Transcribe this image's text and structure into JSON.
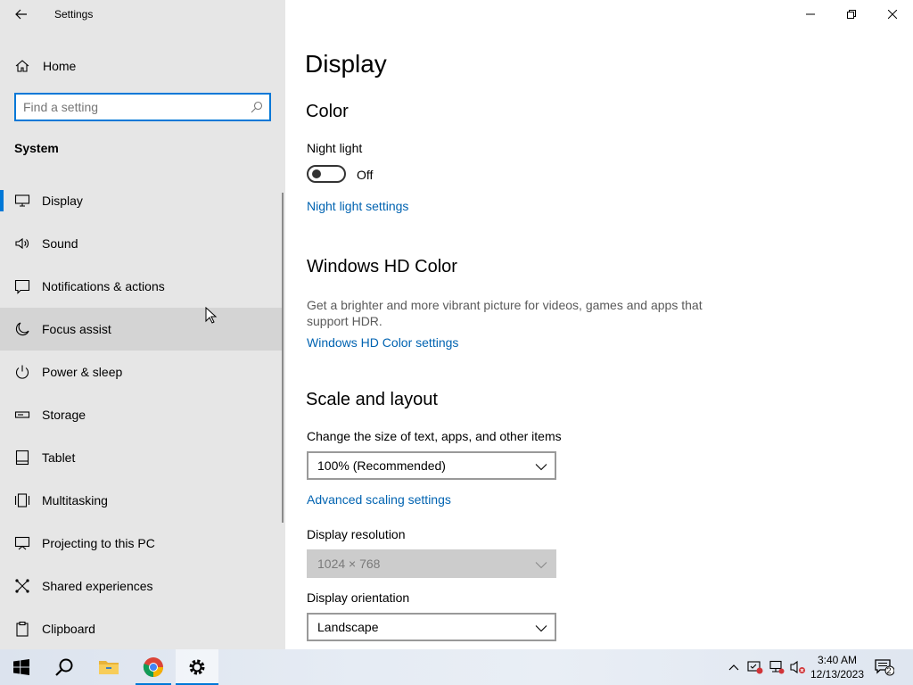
{
  "app": {
    "title": "Settings",
    "home_label": "Home",
    "search_placeholder": "Find a setting",
    "section_label": "System"
  },
  "sidebar": {
    "items": [
      {
        "label": "Display",
        "icon": "monitor-icon",
        "selected": true
      },
      {
        "label": "Sound",
        "icon": "speaker-icon"
      },
      {
        "label": "Notifications & actions",
        "icon": "notification-icon"
      },
      {
        "label": "Focus assist",
        "icon": "moon-icon",
        "hover": true
      },
      {
        "label": "Power & sleep",
        "icon": "power-icon"
      },
      {
        "label": "Storage",
        "icon": "storage-icon"
      },
      {
        "label": "Tablet",
        "icon": "tablet-icon"
      },
      {
        "label": "Multitasking",
        "icon": "multitasking-icon"
      },
      {
        "label": "Projecting to this PC",
        "icon": "projecting-icon"
      },
      {
        "label": "Shared experiences",
        "icon": "shared-icon"
      },
      {
        "label": "Clipboard",
        "icon": "clipboard-icon"
      }
    ]
  },
  "main": {
    "page_title": "Display",
    "color": {
      "heading": "Color",
      "night_light_label": "Night light",
      "night_light_state": "Off",
      "night_light_link": "Night light settings"
    },
    "hd_color": {
      "heading": "Windows HD Color",
      "description": "Get a brighter and more vibrant picture for videos, games and apps that support HDR.",
      "link": "Windows HD Color settings"
    },
    "scale_layout": {
      "heading": "Scale and layout",
      "scale_label": "Change the size of text, apps, and other items",
      "scale_value": "100% (Recommended)",
      "advanced_link": "Advanced scaling settings",
      "resolution_label": "Display resolution",
      "resolution_value": "1024 × 768",
      "orientation_label": "Display orientation",
      "orientation_value": "Landscape"
    }
  },
  "taskbar": {
    "clock_time": "3:40 AM",
    "clock_date": "12/13/2023",
    "notification_count": "2"
  },
  "colors": {
    "accent": "#0078d7",
    "link": "#0063b1",
    "sidebar_bg": "#e6e6e6"
  }
}
